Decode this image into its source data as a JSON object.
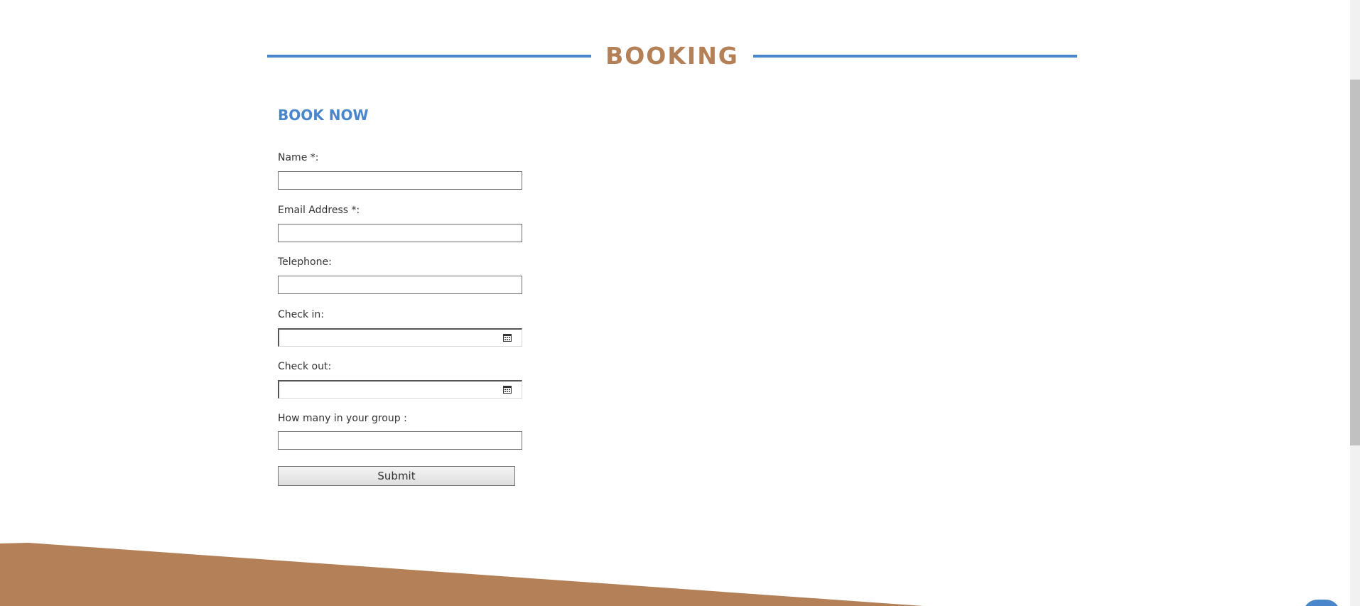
{
  "section": {
    "title": "BOOKING"
  },
  "form": {
    "heading": "BOOK NOW",
    "fields": {
      "name": {
        "label": "Name *:",
        "value": ""
      },
      "email": {
        "label": "Email Address *:",
        "value": ""
      },
      "telephone": {
        "label": "Telephone:",
        "value": ""
      },
      "check_in": {
        "label": "Check in:",
        "value": ""
      },
      "check_out": {
        "label": "Check out:",
        "value": ""
      },
      "group_size": {
        "label": "How many in your group :",
        "value": ""
      }
    },
    "submit_label": "Submit"
  },
  "icons": {
    "calendar": "calendar-icon",
    "chat": "chat-icon"
  },
  "colors": {
    "accent_blue": "#4a86cc",
    "brand_brown": "#b38057"
  }
}
